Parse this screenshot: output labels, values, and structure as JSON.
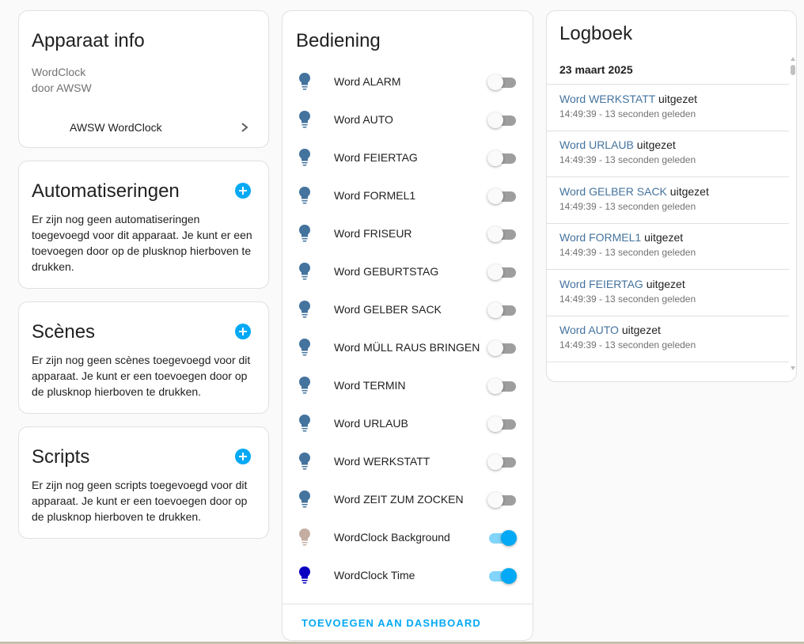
{
  "device_info": {
    "title": "Apparaat info",
    "model": "WordClock",
    "manufacturer": "door AWSW",
    "device_link": "AWSW WordClock",
    "icon": "chevron-right-icon"
  },
  "automations": {
    "title": "Automatiseringen",
    "description": "Er zijn nog geen automatiseringen toegevoegd voor dit apparaat. Je kunt er een toevoegen door op de plusknop hierboven te drukken.",
    "icon": "plus-circle-icon"
  },
  "scenes": {
    "title": "Scènes",
    "description": "Er zijn nog geen scènes toegevoegd voor dit apparaat. Je kunt er een toevoegen door op de plusknop hierboven te drukken.",
    "icon": "plus-circle-icon"
  },
  "scripts": {
    "title": "Scripts",
    "description": "Er zijn nog geen scripts toegevoegd voor dit apparaat. Je kunt er een toevoegen door op de plusknop hierboven te drukken.",
    "icon": "plus-circle-icon"
  },
  "controls": {
    "title": "Bediening",
    "footer_button": "TOEVOEGEN AAN DASHBOARD",
    "items": [
      {
        "label": "Word ALARM",
        "on": false,
        "icon": "lightbulb-icon",
        "color": "#44739e"
      },
      {
        "label": "Word AUTO",
        "on": false,
        "icon": "lightbulb-icon",
        "color": "#44739e"
      },
      {
        "label": "Word FEIERTAG",
        "on": false,
        "icon": "lightbulb-icon",
        "color": "#44739e"
      },
      {
        "label": "Word FORMEL1",
        "on": false,
        "icon": "lightbulb-icon",
        "color": "#44739e"
      },
      {
        "label": "Word FRISEUR",
        "on": false,
        "icon": "lightbulb-icon",
        "color": "#44739e"
      },
      {
        "label": "Word GEBURTSTAG",
        "on": false,
        "icon": "lightbulb-icon",
        "color": "#44739e"
      },
      {
        "label": "Word GELBER SACK",
        "on": false,
        "icon": "lightbulb-icon",
        "color": "#44739e"
      },
      {
        "label": "Word MÜLL RAUS BRINGEN",
        "on": false,
        "icon": "lightbulb-icon",
        "color": "#44739e"
      },
      {
        "label": "Word TERMIN",
        "on": false,
        "icon": "lightbulb-icon",
        "color": "#44739e"
      },
      {
        "label": "Word URLAUB",
        "on": false,
        "icon": "lightbulb-icon",
        "color": "#44739e"
      },
      {
        "label": "Word WERKSTATT",
        "on": false,
        "icon": "lightbulb-icon",
        "color": "#44739e"
      },
      {
        "label": "Word ZEIT ZUM ZOCKEN",
        "on": false,
        "icon": "lightbulb-icon",
        "color": "#44739e"
      },
      {
        "label": "WordClock Background",
        "on": true,
        "icon": "lightbulb-icon",
        "color": "#c4aea2"
      },
      {
        "label": "WordClock Time",
        "on": true,
        "icon": "lightbulb-icon",
        "color": "#0a00c2"
      }
    ]
  },
  "logbook": {
    "title": "Logboek",
    "date": "23 maart 2025",
    "entries": [
      {
        "entity": "Word WERKSTATT",
        "action": " uitgezet",
        "time": "14:49:39 - 13 seconden geleden"
      },
      {
        "entity": "Word URLAUB",
        "action": " uitgezet",
        "time": "14:49:39 - 13 seconden geleden"
      },
      {
        "entity": "Word GELBER SACK",
        "action": " uitgezet",
        "time": "14:49:39 - 13 seconden geleden"
      },
      {
        "entity": "Word FORMEL1",
        "action": " uitgezet",
        "time": "14:49:39 - 13 seconden geleden"
      },
      {
        "entity": "Word FEIERTAG",
        "action": " uitgezet",
        "time": "14:49:39 - 13 seconden geleden"
      },
      {
        "entity": "Word AUTO",
        "action": " uitgezet",
        "time": "14:49:39 - 13 seconden geleden"
      }
    ]
  },
  "colors": {
    "accent": "#03a9f4",
    "entity_link": "#44739e",
    "secondary_text": "#727272"
  }
}
